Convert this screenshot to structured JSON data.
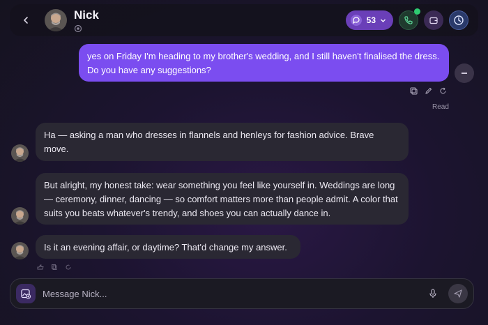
{
  "header": {
    "contact_name": "Nick",
    "pill_count": "53",
    "icons": {
      "back": "chevron-left-icon",
      "status": "settings-ring-icon",
      "chat": "chat-bubble-icon",
      "pill_caret": "chevron-down-icon",
      "call": "phone-call-icon",
      "wallet": "wallet-icon",
      "timer": "clock-icon"
    }
  },
  "messages": {
    "user_1": "yes on Friday I'm heading to my brother's wedding, and I still haven't finalised the dress. Do you have any suggestions?",
    "user_1_status": "Read",
    "bot_1": "Ha — asking a man who dresses in flannels and henleys for fashion advice. Brave move.",
    "bot_2": "But alright, my honest take: wear something you feel like yourself in. Weddings are long — ceremony, dinner, dancing — so comfort matters more than people admit. A color that suits you beats whatever's trendy, and shoes you can actually dance in.",
    "bot_3": "Is it an evening affair, or daytime? That'd change my answer."
  },
  "composer": {
    "placeholder": "Message Nick...",
    "icons": {
      "image": "image-upload-icon",
      "mic": "microphone-icon",
      "send": "send-icon"
    }
  },
  "colors": {
    "accent": "#7b4df0",
    "pill": "#6a3fb8",
    "online": "#2ecc71",
    "bot_bubble": "#2a2833"
  }
}
